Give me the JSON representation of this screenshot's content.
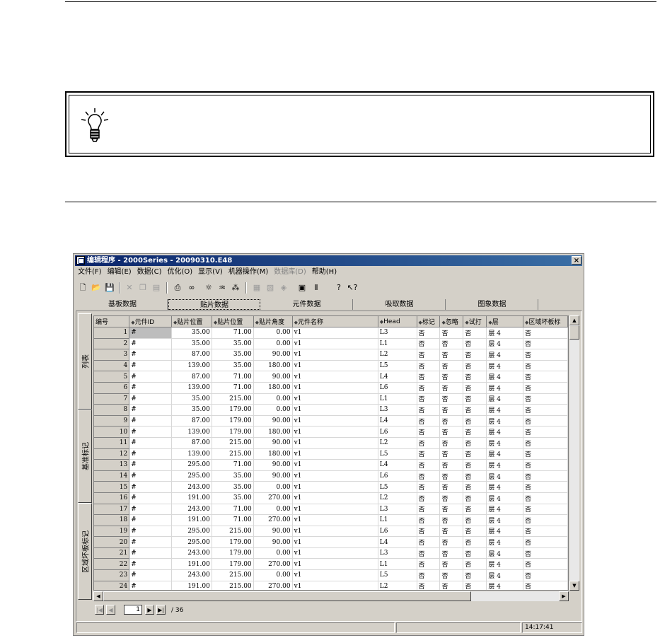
{
  "window": {
    "title": "编辑程序 - 2000Series - 20090310.E48",
    "close_glyph": "×"
  },
  "menu": [
    "文件(F)",
    "编辑(E)",
    "数据(C)",
    "优化(O)",
    "显示(V)",
    "机器操作(M)",
    "数据库(D)",
    "帮助(H)"
  ],
  "tabs": [
    "基板数据",
    "贴片数据",
    "元件数据",
    "吸取数据",
    "图象数据"
  ],
  "side_tabs": [
    "列表",
    "基准标记",
    "区域坏板标记"
  ],
  "grid": {
    "columns": [
      "编号",
      "元件ID",
      "贴片位置",
      "贴片位置",
      "贴片角度",
      "元件名称",
      "Head",
      "标记",
      "忽略",
      "试打",
      "层",
      "区域坏板标"
    ],
    "rows": [
      [
        "1",
        "#",
        "35.00",
        "71.00",
        "0.00",
        "v1",
        "L3",
        "否",
        "否",
        "否",
        "层 4",
        "否"
      ],
      [
        "2",
        "#",
        "35.00",
        "35.00",
        "0.00",
        "v1",
        "L1",
        "否",
        "否",
        "否",
        "层 4",
        "否"
      ],
      [
        "3",
        "#",
        "87.00",
        "35.00",
        "90.00",
        "v1",
        "L2",
        "否",
        "否",
        "否",
        "层 4",
        "否"
      ],
      [
        "4",
        "#",
        "139.00",
        "35.00",
        "180.00",
        "v1",
        "L5",
        "否",
        "否",
        "否",
        "层 4",
        "否"
      ],
      [
        "5",
        "#",
        "87.00",
        "71.00",
        "90.00",
        "v1",
        "L4",
        "否",
        "否",
        "否",
        "层 4",
        "否"
      ],
      [
        "6",
        "#",
        "139.00",
        "71.00",
        "180.00",
        "v1",
        "L6",
        "否",
        "否",
        "否",
        "层 4",
        "否"
      ],
      [
        "7",
        "#",
        "35.00",
        "215.00",
        "0.00",
        "v1",
        "L1",
        "否",
        "否",
        "否",
        "层 4",
        "否"
      ],
      [
        "8",
        "#",
        "35.00",
        "179.00",
        "0.00",
        "v1",
        "L3",
        "否",
        "否",
        "否",
        "层 4",
        "否"
      ],
      [
        "9",
        "#",
        "87.00",
        "179.00",
        "90.00",
        "v1",
        "L4",
        "否",
        "否",
        "否",
        "层 4",
        "否"
      ],
      [
        "10",
        "#",
        "139.00",
        "179.00",
        "180.00",
        "v1",
        "L6",
        "否",
        "否",
        "否",
        "层 4",
        "否"
      ],
      [
        "11",
        "#",
        "87.00",
        "215.00",
        "90.00",
        "v1",
        "L2",
        "否",
        "否",
        "否",
        "层 4",
        "否"
      ],
      [
        "12",
        "#",
        "139.00",
        "215.00",
        "180.00",
        "v1",
        "L5",
        "否",
        "否",
        "否",
        "层 4",
        "否"
      ],
      [
        "13",
        "#",
        "295.00",
        "71.00",
        "90.00",
        "v1",
        "L4",
        "否",
        "否",
        "否",
        "层 4",
        "否"
      ],
      [
        "14",
        "#",
        "295.00",
        "35.00",
        "90.00",
        "v1",
        "L6",
        "否",
        "否",
        "否",
        "层 4",
        "否"
      ],
      [
        "15",
        "#",
        "243.00",
        "35.00",
        "0.00",
        "v1",
        "L5",
        "否",
        "否",
        "否",
        "层 4",
        "否"
      ],
      [
        "16",
        "#",
        "191.00",
        "35.00",
        "270.00",
        "v1",
        "L2",
        "否",
        "否",
        "否",
        "层 4",
        "否"
      ],
      [
        "17",
        "#",
        "243.00",
        "71.00",
        "0.00",
        "v1",
        "L3",
        "否",
        "否",
        "否",
        "层 4",
        "否"
      ],
      [
        "18",
        "#",
        "191.00",
        "71.00",
        "270.00",
        "v1",
        "L1",
        "否",
        "否",
        "否",
        "层 4",
        "否"
      ],
      [
        "19",
        "#",
        "295.00",
        "215.00",
        "90.00",
        "v1",
        "L6",
        "否",
        "否",
        "否",
        "层 4",
        "否"
      ],
      [
        "20",
        "#",
        "295.00",
        "179.00",
        "90.00",
        "v1",
        "L4",
        "否",
        "否",
        "否",
        "层 4",
        "否"
      ],
      [
        "21",
        "#",
        "243.00",
        "179.00",
        "0.00",
        "v1",
        "L3",
        "否",
        "否",
        "否",
        "层 4",
        "否"
      ],
      [
        "22",
        "#",
        "191.00",
        "179.00",
        "270.00",
        "v1",
        "L1",
        "否",
        "否",
        "否",
        "层 4",
        "否"
      ],
      [
        "23",
        "#",
        "243.00",
        "215.00",
        "0.00",
        "v1",
        "L5",
        "否",
        "否",
        "否",
        "层 4",
        "否"
      ],
      [
        "24",
        "#",
        "191.00",
        "215.00",
        "270.00",
        "v1",
        "L2",
        "否",
        "否",
        "否",
        "层 4",
        "否"
      ]
    ]
  },
  "pager": {
    "current": "1",
    "total": "/ 36"
  },
  "status": {
    "time": "14:17:41"
  }
}
